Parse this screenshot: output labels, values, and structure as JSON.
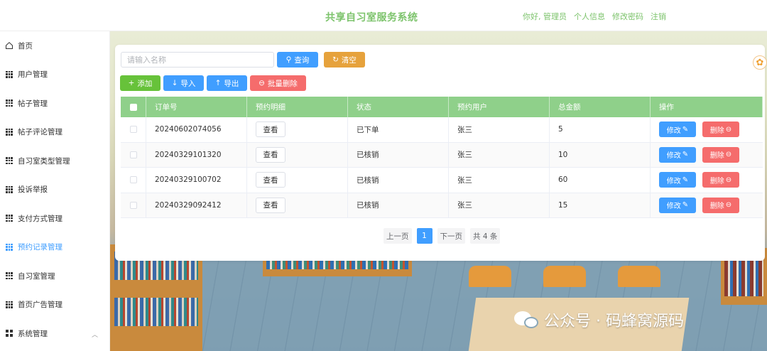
{
  "header": {
    "title": "共享自习室服务系统",
    "greeting": "你好, 管理员",
    "profile": "个人信息",
    "change_password": "修改密码",
    "logout": "注销"
  },
  "sidebar": {
    "items": [
      {
        "label": "首页"
      },
      {
        "label": "用户管理"
      },
      {
        "label": "帖子管理"
      },
      {
        "label": "帖子评论管理"
      },
      {
        "label": "自习室类型管理"
      },
      {
        "label": "投诉举报"
      },
      {
        "label": "支付方式管理"
      },
      {
        "label": "预约记录管理"
      },
      {
        "label": "自习室管理"
      },
      {
        "label": "首页广告管理"
      },
      {
        "label": "系统管理"
      }
    ],
    "active_index": 7
  },
  "toolbar": {
    "search_placeholder": "请输入名称",
    "query": "查询",
    "clear": "清空",
    "add": "添加",
    "import": "导入",
    "export": "导出",
    "batch_delete": "批量删除"
  },
  "table": {
    "headers": [
      "订单号",
      "预约明细",
      "状态",
      "预约用户",
      "总金额",
      "操作"
    ],
    "view_label": "查看",
    "edit_label": "修改",
    "delete_label": "删除",
    "rows": [
      {
        "order_no": "20240602074056",
        "status": "已下单",
        "user": "张三",
        "amount": "5"
      },
      {
        "order_no": "20240329101320",
        "status": "已核销",
        "user": "张三",
        "amount": "10"
      },
      {
        "order_no": "20240329100702",
        "status": "已核销",
        "user": "张三",
        "amount": "60"
      },
      {
        "order_no": "20240329092412",
        "status": "已核销",
        "user": "张三",
        "amount": "15"
      }
    ]
  },
  "pagination": {
    "prev": "上一页",
    "current": "1",
    "next": "下一页",
    "total": "共 4 条"
  },
  "watermark": {
    "text": "公众号 · 码蜂窝源码"
  },
  "colors": {
    "primary": "#409eff",
    "success": "#67c23a",
    "warning": "#e6a23c",
    "danger": "#f56c6c",
    "header_green": "#7cc36b",
    "table_head": "#8fd08a"
  }
}
